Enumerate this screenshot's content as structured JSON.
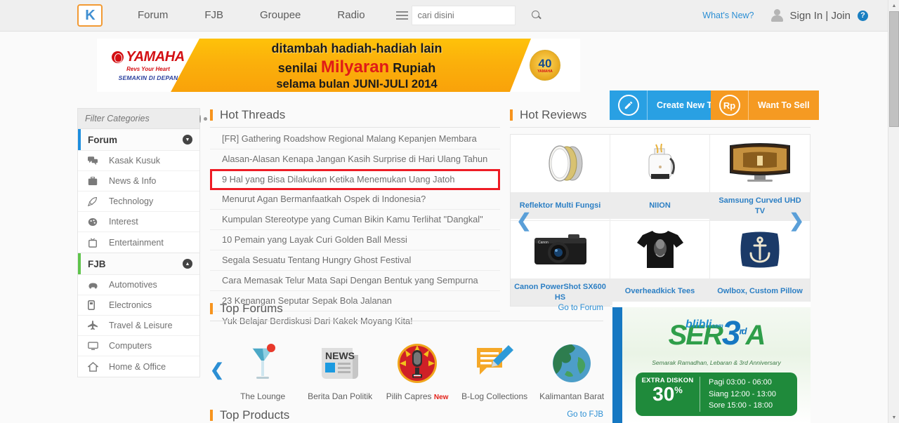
{
  "header": {
    "logo_text": "K",
    "logo_icon": "kaskus-k-logo",
    "nav": [
      {
        "label": "Forum"
      },
      {
        "label": "FJB"
      },
      {
        "label": "Groupee"
      },
      {
        "label": "Radio"
      }
    ],
    "menu_icon": "hamburger-icon",
    "search": {
      "placeholder": "cari disini",
      "value": "",
      "icon": "search-icon"
    },
    "whats_new": "What's New?",
    "avatar_icon": "user-avatar-icon",
    "sign_in": "Sign In",
    "separator": "|",
    "join": "Join",
    "help_icon_label": "?"
  },
  "banner": {
    "brand": "YAMAHA",
    "tagline": "Revs Your Heart",
    "slogan": "SEMAKIN DI DEPAN",
    "line1": "ditambah hadiah-hadiah lain",
    "line2_pre": "senilai ",
    "line2_em": "Milyaran",
    "line2_post": " Rupiah",
    "line3": "selama bulan JUNI-JULI 2014",
    "badge_number": "40",
    "badge_sub": "YAMAHA"
  },
  "cta": {
    "create_thread": {
      "label": "Create New Thread",
      "icon": "pencil-icon",
      "color": "#29a0e3"
    },
    "want_to_sell": {
      "label": "Want To Sell",
      "icon": "rupiah-icon",
      "symbol": "Rp",
      "color": "#f59a22"
    }
  },
  "sidebar": {
    "filter": {
      "placeholder": "Filter Categories",
      "value": "",
      "eye_icon": "eye-icon"
    },
    "groups": [
      {
        "title": "Forum",
        "accent": "#1e8ede",
        "chevron": "chevron-down-icon",
        "items": [
          {
            "label": "Kasak Kusuk",
            "icon": "chat-bubbles-icon"
          },
          {
            "label": "News & Info",
            "icon": "briefcase-icon"
          },
          {
            "label": "Technology",
            "icon": "rocket-icon"
          },
          {
            "label": "Interest",
            "icon": "palette-icon"
          },
          {
            "label": "Entertainment",
            "icon": "tv-icon"
          }
        ]
      },
      {
        "title": "FJB",
        "accent": "#5fc44c",
        "chevron": "chevron-up-icon",
        "items": [
          {
            "label": "Automotives",
            "icon": "car-icon"
          },
          {
            "label": "Electronics",
            "icon": "mobile-phone-icon"
          },
          {
            "label": "Travel & Leisure",
            "icon": "airplane-icon"
          },
          {
            "label": "Computers",
            "icon": "monitor-icon"
          },
          {
            "label": "Home & Office",
            "icon": "home-icon"
          }
        ]
      }
    ]
  },
  "hot_threads": {
    "title": "Hot Threads",
    "items": [
      {
        "label": "[FR] Gathering Roadshow Regional Malang Kepanjen Membara",
        "highlighted": false
      },
      {
        "label": "Alasan-Alasan Kenapa Jangan Kasih Surprise di Hari Ulang Tahun",
        "highlighted": false
      },
      {
        "label": "9 Hal yang Bisa Dilakukan Ketika Menemukan Uang Jatoh",
        "highlighted": true
      },
      {
        "label": "Menurut Agan Bermanfaatkah Ospek di Indonesia?",
        "highlighted": false
      },
      {
        "label": "Kumpulan Stereotype yang Cuman Bikin Kamu Terlihat \"Dangkal\"",
        "highlighted": false
      },
      {
        "label": "10 Pemain yang Layak Curi Golden Ball Messi",
        "highlighted": false
      },
      {
        "label": "Segala Sesuatu Tentang Hungry Ghost Festival",
        "highlighted": false
      },
      {
        "label": "Cara Memasak Telur Mata Sapi Dengan Bentuk yang Sempurna",
        "highlighted": false
      },
      {
        "label": "23 Kenangan Seputar Sepak Bola Jalanan",
        "highlighted": false
      },
      {
        "label": "Yuk Belajar Berdiskusi Dari Kakek Moyang Kita!",
        "highlighted": false
      }
    ],
    "highlight_color": "#ee1c25"
  },
  "hot_reviews": {
    "title": "Hot Reviews",
    "prev_icon": "chevron-left-icon",
    "next_icon": "chevron-right-icon",
    "items": [
      {
        "label": "Reflektor Multi Fungsi",
        "icon": "reflector-disc-image"
      },
      {
        "label": "NIION",
        "icon": "backpack-image"
      },
      {
        "label": "Samsung Curved UHD TV",
        "icon": "curved-tv-image"
      },
      {
        "label": "Canon PowerShot SX600 HS",
        "icon": "camera-image"
      },
      {
        "label": "Overheadkick Tees",
        "icon": "tshirt-image"
      },
      {
        "label": "Owlbox, Custom Pillow",
        "icon": "anchor-pillow-image"
      }
    ]
  },
  "top_forums": {
    "title": "Top Forums",
    "goto": "Go to Forum",
    "prev_icon": "chevron-left-icon",
    "next_icon": "chevron-right-icon",
    "items": [
      {
        "label": "The Lounge",
        "badge": "",
        "icon": "cocktail-glass-icon"
      },
      {
        "label": "Berita Dan Politik",
        "badge": "",
        "icon": "newspaper-icon"
      },
      {
        "label": "Pilih Capres",
        "badge": "New",
        "icon": "microphone-icon"
      },
      {
        "label": "B-Log Collections",
        "badge": "",
        "icon": "pencil-note-icon"
      },
      {
        "label": "Kalimantan Barat",
        "badge": "",
        "icon": "globe-icon"
      }
    ]
  },
  "top_products": {
    "title": "Top Products",
    "goto": "Go to FJB"
  },
  "right_ad": {
    "brand": "blibli",
    "brand_small": "com",
    "word_pre": "SER",
    "word_num": "3",
    "word_sup": "rd",
    "word_post": "A",
    "subtitle": "Semarak Ramadhan, Lebaran & 3rd Anniversary",
    "panel_title": "EXTRA DISKON",
    "panel_pct": "30",
    "panel_pct_sym": "%",
    "times": [
      "Pagi 03:00 - 06:00",
      "Siang 12:00 - 13:00",
      "Sore 15:00 - 18:00"
    ]
  },
  "colors": {
    "accent_orange": "#f7941e",
    "link_blue": "#2c8fd4",
    "forum_accent": "#1e8ede",
    "fjb_accent": "#5fc44c",
    "highlight_red": "#ee1c25"
  }
}
